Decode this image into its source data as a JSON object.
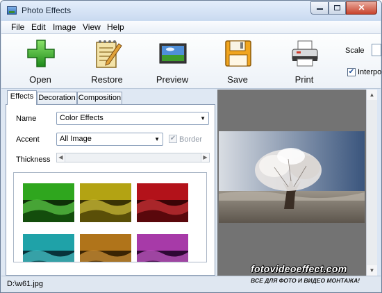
{
  "window": {
    "title": "Photo Effects"
  },
  "menu": [
    "File",
    "Edit",
    "Image",
    "View",
    "Help"
  ],
  "toolbar": {
    "tools": [
      {
        "label": "Open",
        "icon": "open-plus-icon"
      },
      {
        "label": "Restore",
        "icon": "restore-notepad-icon"
      },
      {
        "label": "Preview",
        "icon": "preview-picture-icon"
      },
      {
        "label": "Save",
        "icon": "save-floppy-icon"
      },
      {
        "label": "Print",
        "icon": "print-printer-icon"
      }
    ],
    "scale_label": "Scale",
    "interpolation_label": "Interpo",
    "interpolation_checked": true
  },
  "tabs": [
    "Effects",
    "Decoration",
    "Composition"
  ],
  "active_tab": "Effects",
  "effects": {
    "name_label": "Name",
    "name_value": "Color Effects",
    "accent_label": "Accent",
    "accent_value": "All Image",
    "border_label": "Border",
    "border_checked": true,
    "border_enabled": false,
    "thickness_label": "Thickness"
  },
  "thumbnails": [
    {
      "tint": "#2fa61e"
    },
    {
      "tint": "#b3a313"
    },
    {
      "tint": "#b3121a"
    },
    {
      "tint": "#1fa2a8"
    },
    {
      "tint": "#b0741a"
    },
    {
      "tint": "#a73aa8"
    }
  ],
  "status": {
    "path": "D:\\w61.jpg"
  },
  "watermark": {
    "site": "fotovideoeffect.com",
    "tagline": "ВСЕ ДЛЯ ФОТО И ВИДЕО МОНТАЖА!"
  }
}
